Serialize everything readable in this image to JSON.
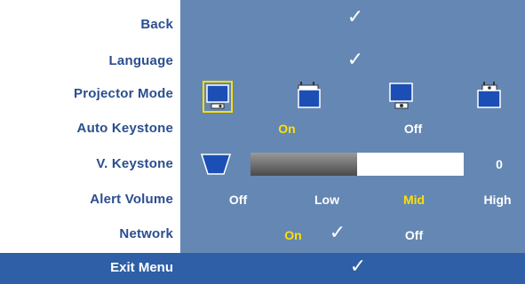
{
  "menu": {
    "back": {
      "label": "Back",
      "check": "✓"
    },
    "language": {
      "label": "Language",
      "check": "✓"
    },
    "projector_mode": {
      "label": "Projector Mode",
      "options": [
        "front-projection-desktop-icon",
        "front-projection-ceiling-icon",
        "rear-projection-desktop-icon",
        "rear-projection-ceiling-icon"
      ],
      "selected_index": 0
    },
    "auto_keystone": {
      "label": "Auto Keystone",
      "on": "On",
      "off": "Off",
      "selected": "On"
    },
    "v_keystone": {
      "label": "V. Keystone",
      "value": "0",
      "slider_level": 0.5
    },
    "alert_volume": {
      "label": "Alert Volume",
      "options": [
        "Off",
        "Low",
        "Mid",
        "High"
      ],
      "selected": "Mid"
    },
    "network": {
      "label": "Network",
      "on": "On",
      "off": "Off",
      "check": "✓",
      "selected": "On"
    },
    "exit": {
      "label": "Exit Menu",
      "check": "✓"
    }
  },
  "colors": {
    "panel": "#6587b3",
    "exit_bar": "#2f5fa6",
    "label": "#2a4e8f",
    "selected": "#ffe000",
    "text": "#ffffff"
  }
}
